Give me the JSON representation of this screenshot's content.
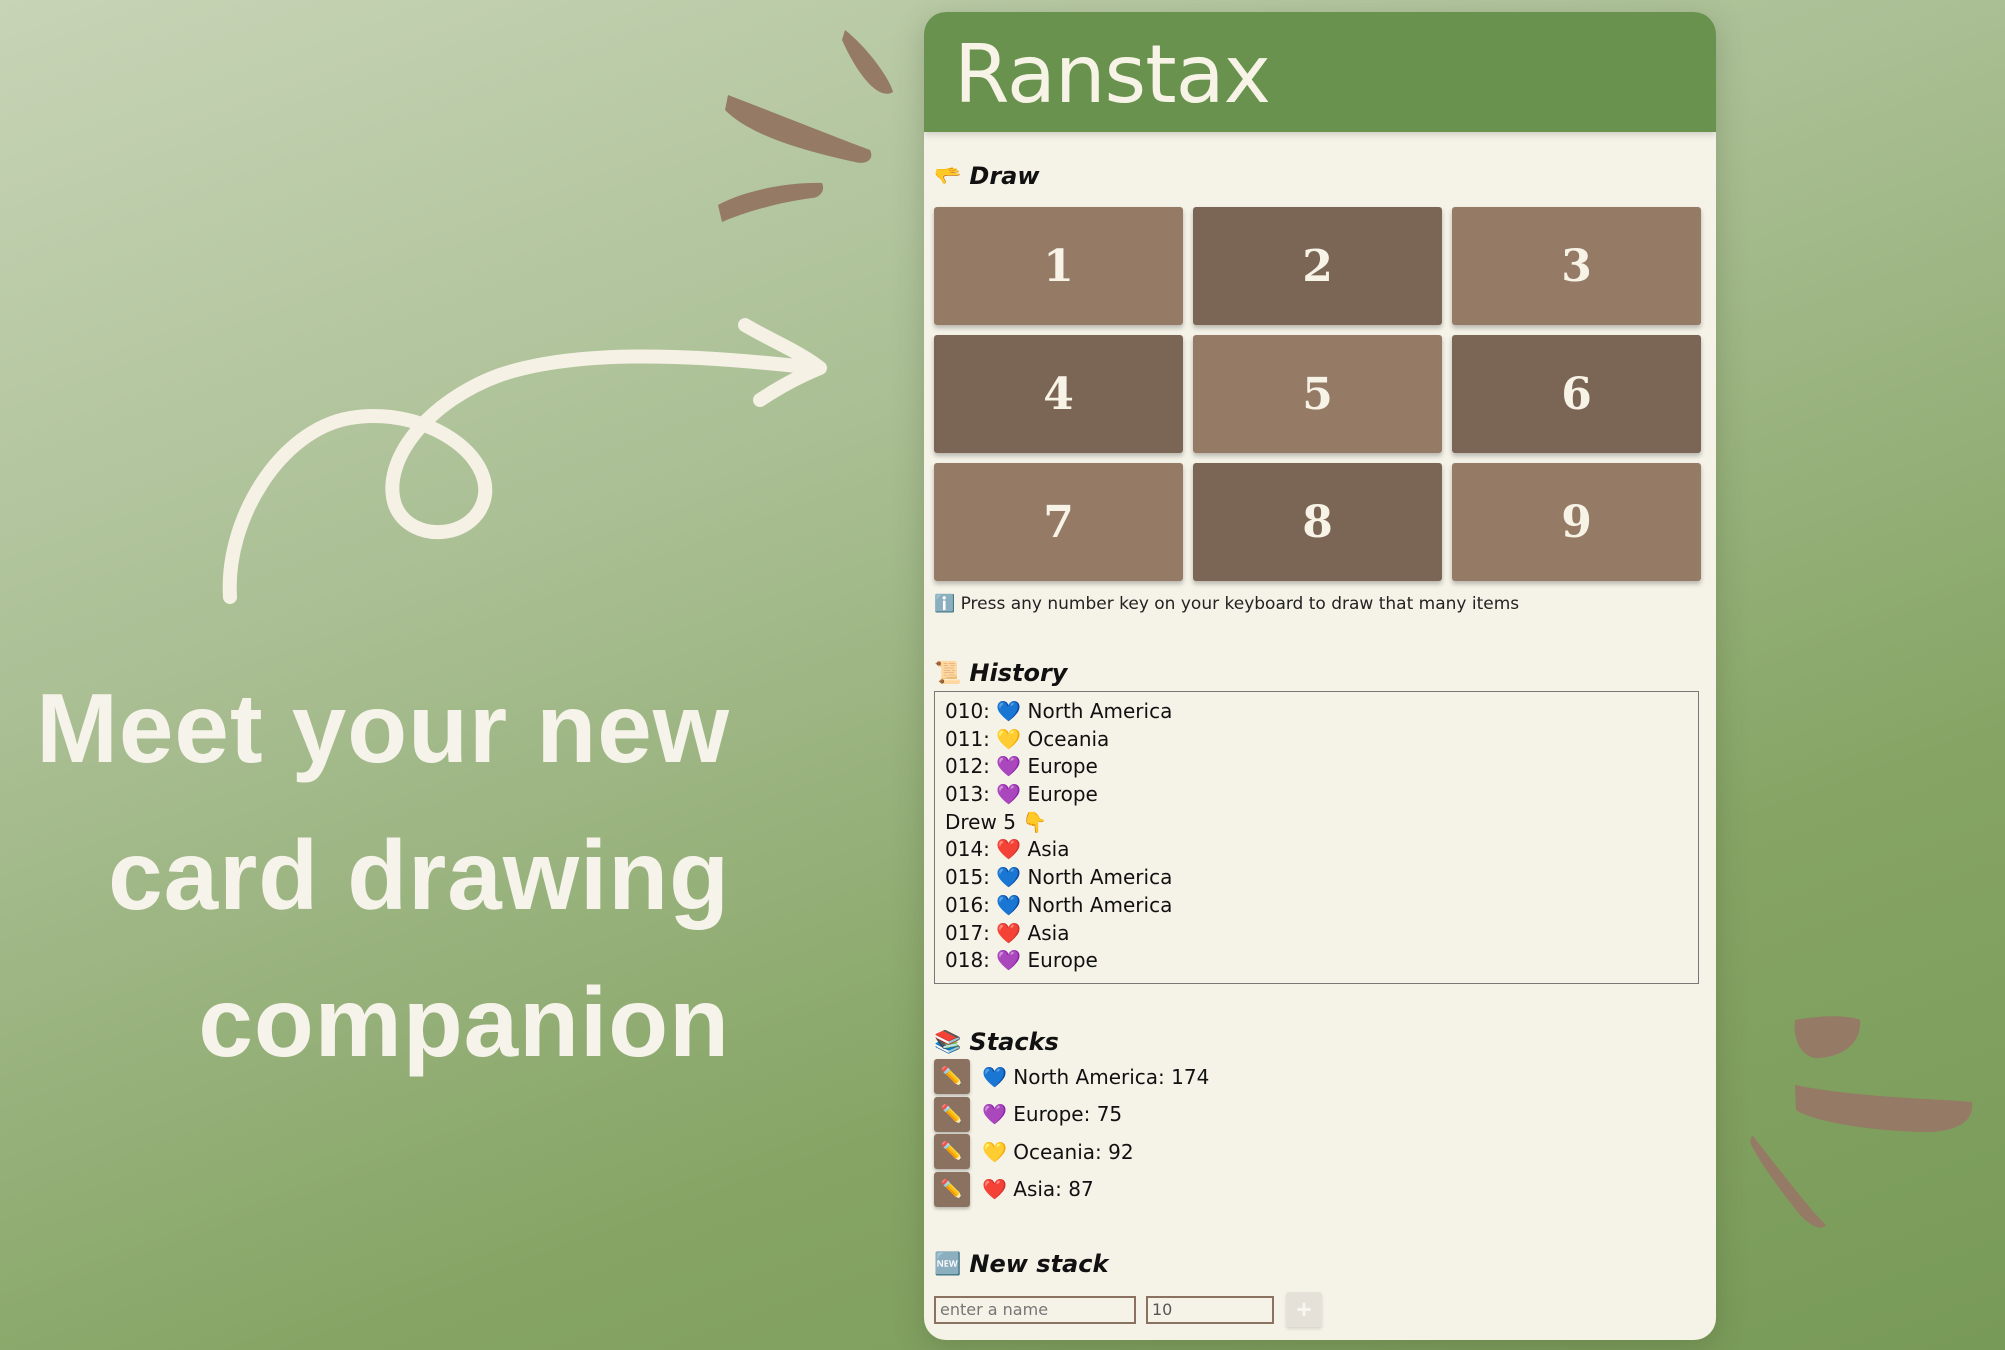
{
  "tagline": [
    "Meet your new",
    "card drawing",
    "companion"
  ],
  "app": {
    "title": "Ranstax",
    "draw": {
      "icon": "🫳",
      "title": "Draw",
      "buttons": [
        "1",
        "2",
        "3",
        "4",
        "5",
        "6",
        "7",
        "8",
        "9"
      ],
      "hint": "ℹ️ Press any number key on your keyboard to draw that many items"
    },
    "history": {
      "icon": "📜",
      "title": "History",
      "lines": [
        "010: 💙 North America",
        "011: 💛 Oceania",
        "012: 💜 Europe",
        "013: 💜 Europe",
        "Drew 5 👇",
        "014: ❤️ Asia",
        "015: 💙 North America",
        "016: 💙 North America",
        "017: ❤️ Asia",
        "018: 💜 Europe"
      ]
    },
    "stacks": {
      "icon": "📚",
      "title": "Stacks",
      "edit_icon": "✏️",
      "items": [
        "💙 North America: 174",
        "💜 Europe: 75",
        "💛 Oceania: 92",
        "❤️ Asia: 87"
      ]
    },
    "new_stack": {
      "icon": "🆕",
      "title": "New stack",
      "name_placeholder": "enter a name",
      "count_value": "10",
      "add_label": "+"
    }
  },
  "colors": {
    "header": "#68924d",
    "card_light": "#957a66",
    "card_dark": "#7b6554",
    "panel": "#f5f3e8",
    "tagline": "#f6f3ea"
  }
}
